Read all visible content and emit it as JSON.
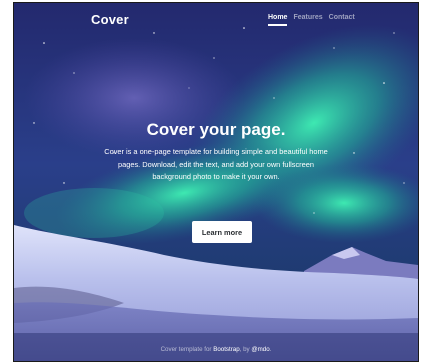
{
  "brand": "Cover",
  "nav": {
    "items": [
      "Home",
      "Features",
      "Contact"
    ],
    "active": "Home"
  },
  "hero": {
    "title": "Cover your page.",
    "lead": "Cover is a one-page template for building simple and beautiful home pages. Download, edit the text, and add your own fullscreen background photo to make it your own.",
    "button": "Learn more"
  },
  "footer": {
    "prefix": "Cover template for ",
    "link1": "Bootstrap",
    "middle": ", by ",
    "link2": "@mdo",
    "suffix": "."
  },
  "colors": {
    "sky_top": "#20266a",
    "aurora_green": "#2fd7a0",
    "snow": "#cdd3f3",
    "button_text": "#2b2f33"
  }
}
